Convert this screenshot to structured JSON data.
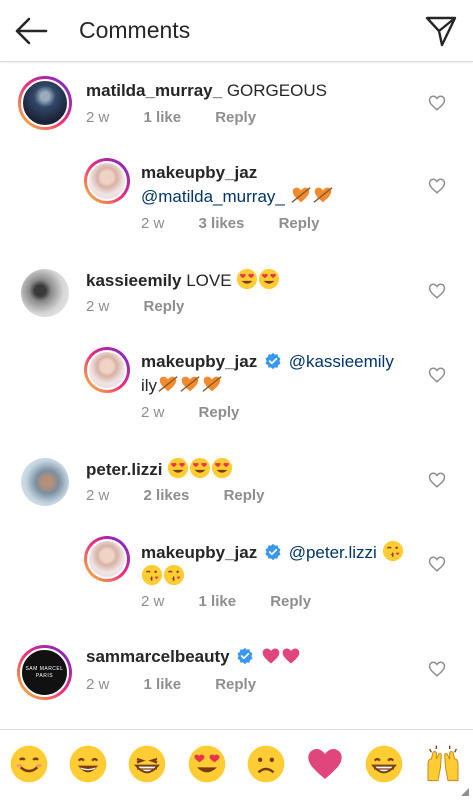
{
  "header": {
    "title": "Comments"
  },
  "comments": [
    {
      "username": "matilda_murray_",
      "text": "GORGEOUS",
      "time": "2 w",
      "likes": "1 like",
      "reply": "Reply",
      "verified": false,
      "avatar_icon": "profile-photo"
    },
    {
      "username": "makeupby_jaz",
      "mention": "@matilda_murray_",
      "time": "2 w",
      "likes": "3 likes",
      "reply": "Reply",
      "avatar_icon": "profile-photo"
    },
    {
      "username": "kassieemily",
      "text": "LOVE",
      "time": "2 w",
      "reply": "Reply",
      "avatar_icon": "profile-photo"
    },
    {
      "username": "makeupby_jaz",
      "mention": "@kassieemily",
      "text": "ily",
      "time": "2 w",
      "reply": "Reply",
      "verified": true,
      "avatar_icon": "profile-photo"
    },
    {
      "username": "peter.lizzi",
      "time": "2 w",
      "likes": "2 likes",
      "reply": "Reply",
      "avatar_icon": "profile-photo"
    },
    {
      "username": "makeupby_jaz",
      "mention": "@peter.lizzi",
      "time": "2 w",
      "likes": "1 like",
      "reply": "Reply",
      "verified": true,
      "avatar_icon": "profile-photo"
    },
    {
      "username": "sammarcelbeauty",
      "time": "2 w",
      "likes": "1 like",
      "reply": "Reply",
      "verified": true,
      "avatar_text_line1": "SAM MARCEL",
      "avatar_text_line2": "PARIS"
    }
  ],
  "emoji_bar": [
    "smiling-face",
    "grinning-face",
    "beaming-face",
    "heart-eyes-face",
    "frowning-face",
    "red-heart",
    "grinning-big-eyes-face",
    "raising-hands"
  ],
  "colors": {
    "mention": "#003569",
    "meta": "#8e8e8e",
    "verified": "#3897f0",
    "heart_pink": "#e0457b"
  }
}
